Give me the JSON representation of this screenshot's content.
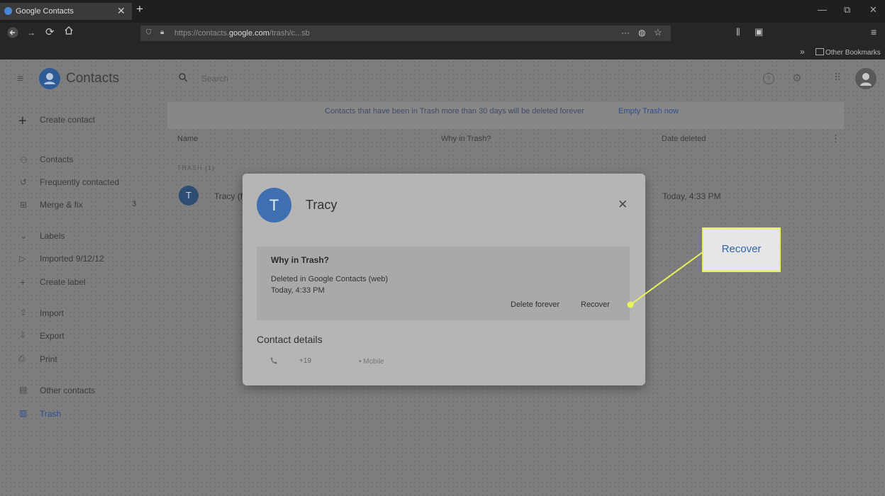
{
  "browser": {
    "tab_title": "Google Contacts",
    "tab_close": "✕",
    "new_tab": "+",
    "window_controls": [
      "—",
      "⧉",
      "✕"
    ],
    "url_prefix": "https://contacts.",
    "url_domain": "google.com",
    "url_path": "/trash/c...sb",
    "url_actions": "···",
    "bookmarks_chevron": "»",
    "bookmarks_other": "Other Bookmarks"
  },
  "app": {
    "title": "Contacts",
    "search_placeholder": "Search",
    "header_icons": [
      "help-icon",
      "settings-icon",
      "apps-icon",
      "account-avatar"
    ]
  },
  "sidebar": {
    "create_contact": "Create contact",
    "items": [
      {
        "label": "Contacts",
        "icon": "person-icon"
      },
      {
        "label": "Frequently contacted",
        "icon": "history-icon"
      },
      {
        "label": "Merge & fix",
        "icon": "merge-icon",
        "badge": "3"
      },
      {
        "label": "Labels",
        "icon": "chevron-down-icon"
      },
      {
        "label": "Imported 9/12/12",
        "icon": "label-icon"
      },
      {
        "label": "Create label",
        "icon": "plus-icon"
      },
      {
        "label": "Import",
        "icon": "upload-icon"
      },
      {
        "label": "Export",
        "icon": "download-icon"
      },
      {
        "label": "Print",
        "icon": "print-icon"
      },
      {
        "label": "Other contacts",
        "icon": "contacts-icon"
      },
      {
        "label": "Trash",
        "icon": "trash-icon"
      }
    ]
  },
  "trash_page": {
    "banner_text": "Contacts that have been in Trash more than 30 days will be deleted forever",
    "banner_action": "Empty Trash now",
    "columns": [
      "Name",
      "Why in Trash?",
      "Date deleted"
    ],
    "more_icon": "⋮",
    "section_label": "TRASH (1)",
    "row": {
      "initial": "T",
      "name": "Tracy (f",
      "date": "Today, 4:33 PM"
    }
  },
  "dialog": {
    "initial": "T",
    "name": "Tracy",
    "close": "✕",
    "why_title": "Why in Trash?",
    "reason": "Deleted in Google Contacts (web)",
    "date": "Today, 4:33 PM",
    "delete_forever": "Delete forever",
    "recover": "Recover",
    "contact_details_title": "Contact details",
    "phone_number": "+19",
    "phone_label": "• Mobile"
  },
  "callout": {
    "label": "Recover",
    "border_color": "#e8f25a",
    "text_color": "#2a65b8"
  }
}
